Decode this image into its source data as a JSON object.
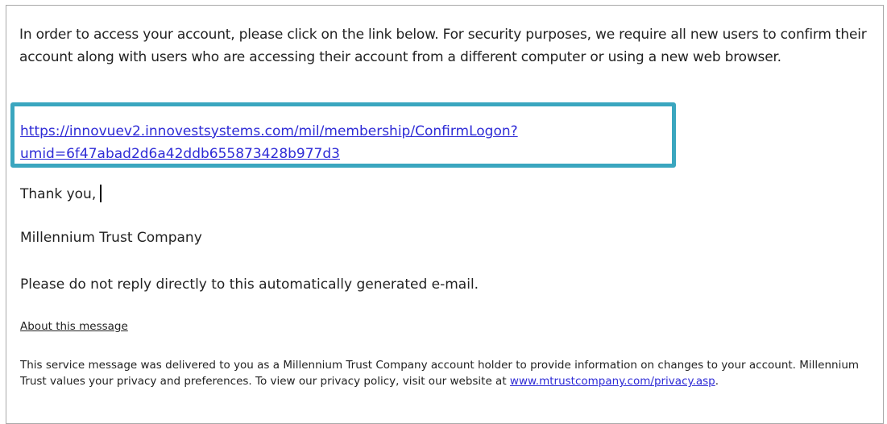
{
  "email": {
    "intro_paragraph": "In order to access your account, please click on the link below. For security purposes, we require all new users to confirm their account along with users who are accessing their account from a different computer or using a new web browser.",
    "link_line_1": "https://innovuev2.innovestsystems.com/mil/membership/ConfirmLogon?",
    "link_line_2": "umid=6f47abad2d6a42ddb655873428b977d3",
    "thanks": "Thank you,",
    "signature": "Millennium Trust Company",
    "no_reply_notice": "Please do not reply directly to this automatically generated e-mail.",
    "about_link": "About this message",
    "footer_text": "This service message was delivered to you as a Millennium Trust Company account holder to provide information on changes to your account. Millennium Trust values your privacy and preferences. To view our privacy policy, visit our website at",
    "footer_link": "www.mtrustcompany.com/privacy.asp",
    "footer_end": "."
  },
  "colors": {
    "highlight_border": "#3aa6bf",
    "link": "#2e2bd6",
    "text": "#222222"
  }
}
